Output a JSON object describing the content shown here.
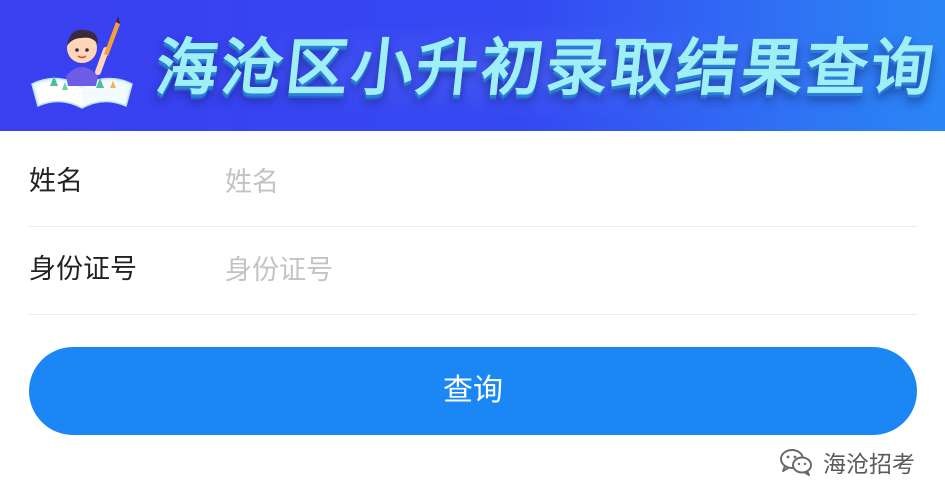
{
  "banner": {
    "title": "海沧区小升初录取结果查询",
    "colors": {
      "background_start": "#3a3ff0",
      "background_end": "#2a86f5",
      "title_text": "#9ff0f6"
    }
  },
  "form": {
    "name_field": {
      "label": "姓名",
      "placeholder": "姓名",
      "value": ""
    },
    "id_field": {
      "label": "身份证号",
      "placeholder": "身份证号",
      "value": ""
    },
    "submit_label": "查询",
    "accent_color": "#1b87f5"
  },
  "watermark": {
    "text": "海沧招考",
    "icon": "wechat-icon"
  }
}
